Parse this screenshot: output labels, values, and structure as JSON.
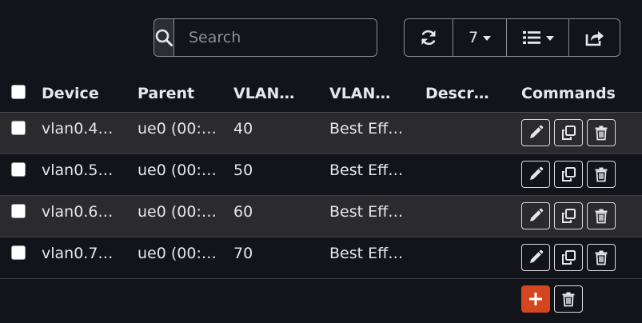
{
  "search": {
    "placeholder": "Search",
    "value": ""
  },
  "toolbar": {
    "refresh_icon": "refresh-icon",
    "rows_per_page": "7",
    "columns_icon": "list-icon",
    "export_icon": "export-icon"
  },
  "table": {
    "headers": {
      "device": "Device",
      "parent": "Parent",
      "vlan_tag": "VLAN…",
      "vlan_priority": "VLAN…",
      "description": "Descr…",
      "commands": "Commands"
    },
    "rows": [
      {
        "device": "vlan0.4…",
        "parent": "ue0 (00:…",
        "tag": "40",
        "priority": "Best Eff…",
        "description": ""
      },
      {
        "device": "vlan0.5…",
        "parent": "ue0 (00:…",
        "tag": "50",
        "priority": "Best Eff…",
        "description": ""
      },
      {
        "device": "vlan0.6…",
        "parent": "ue0 (00:…",
        "tag": "60",
        "priority": "Best Eff…",
        "description": ""
      },
      {
        "device": "vlan0.7…",
        "parent": "ue0 (00:…",
        "tag": "70",
        "priority": "Best Eff…",
        "description": ""
      }
    ]
  },
  "colors": {
    "background": "#13141a",
    "stripe": "#2b2b2d",
    "add_button": "#d4461f"
  }
}
